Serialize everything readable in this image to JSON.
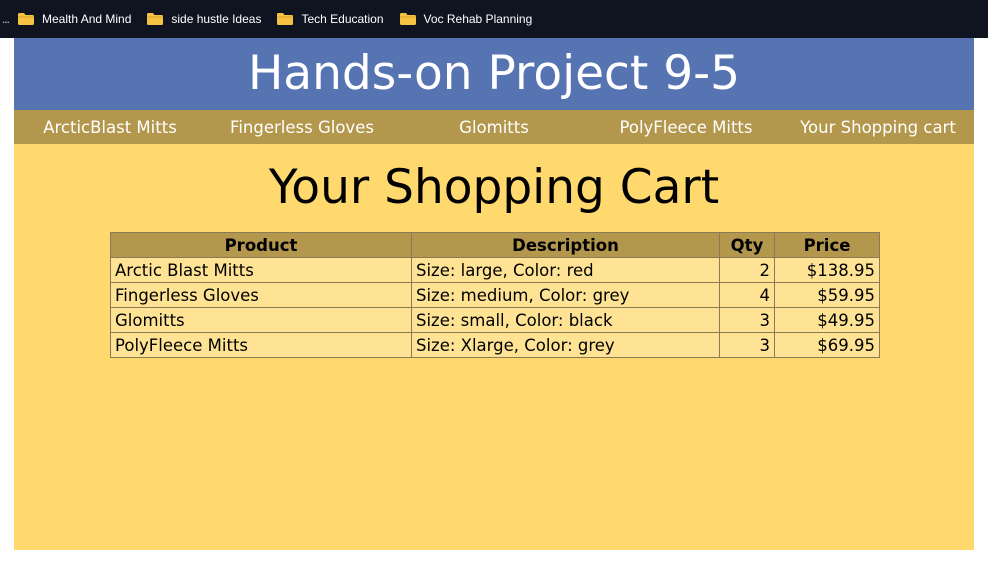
{
  "bookmarks": {
    "overflow": "...",
    "items": [
      {
        "label": "Mealth And Mind",
        "icon": "folder-icon"
      },
      {
        "label": "side hustle Ideas",
        "icon": "folder-icon"
      },
      {
        "label": "Tech Education",
        "icon": "folder-icon"
      },
      {
        "label": "Voc Rehab Planning",
        "icon": "folder-icon"
      }
    ]
  },
  "header": {
    "title": "Hands-on Project 9-5"
  },
  "nav": {
    "items": [
      {
        "label": "ArcticBlast Mitts"
      },
      {
        "label": "Fingerless Gloves"
      },
      {
        "label": "Glomitts"
      },
      {
        "label": "PolyFleece Mitts"
      },
      {
        "label": "Your Shopping cart"
      }
    ]
  },
  "main": {
    "heading": "Your Shopping Cart"
  },
  "cart": {
    "headers": {
      "product": "Product",
      "description": "Description",
      "qty": "Qty",
      "price": "Price"
    },
    "rows": [
      {
        "product": "Arctic Blast Mitts",
        "description": "Size: large, Color: red",
        "qty": "2",
        "price": "$138.95"
      },
      {
        "product": "Fingerless Gloves",
        "description": "Size: medium, Color: grey",
        "qty": "4",
        "price": "$59.95"
      },
      {
        "product": "Glomitts",
        "description": "Size: small, Color: black",
        "qty": "3",
        "price": "$49.95"
      },
      {
        "product": "PolyFleece Mitts",
        "description": "Size: Xlarge, Color: grey",
        "qty": "3",
        "price": "$69.95"
      }
    ]
  },
  "colors": {
    "bookmarks_bg": "#0f1420",
    "header_bg": "#5673b2",
    "nav_bg": "#b3974d",
    "page_bg": "#ffd96e",
    "cell_bg": "#ffe394",
    "folder": "#f5c242"
  }
}
